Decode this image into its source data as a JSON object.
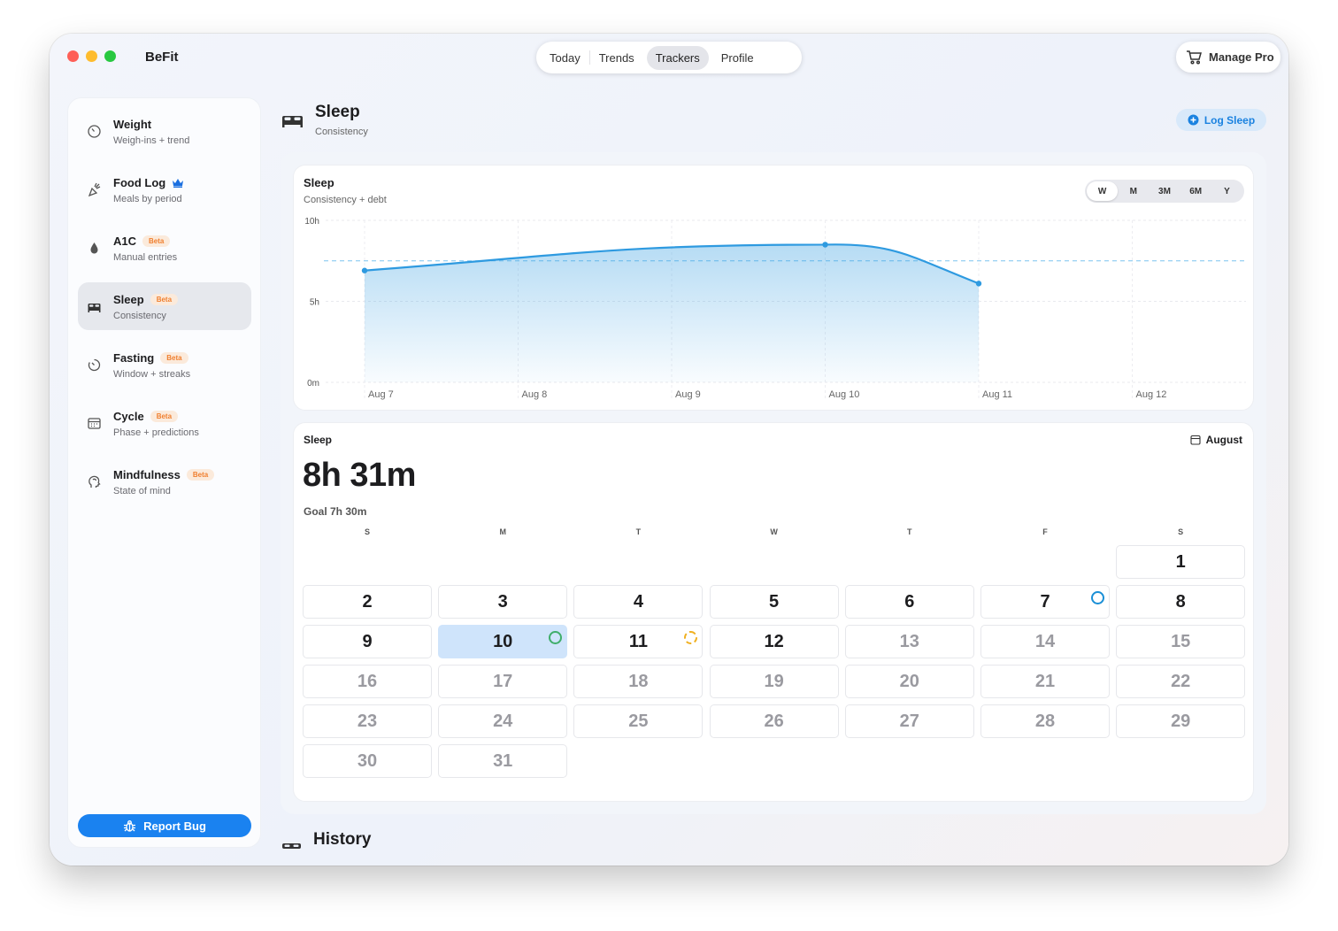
{
  "app": {
    "title": "BeFit"
  },
  "nav": {
    "tabs": [
      {
        "label": "Today"
      },
      {
        "label": "Trends"
      },
      {
        "label": "Trackers",
        "active": true
      },
      {
        "label": "Profile"
      }
    ]
  },
  "manage_pro": {
    "label": "Manage Pro",
    "icon": "cart-icon"
  },
  "sidebar": {
    "items": [
      {
        "title": "Weight",
        "subtitle": "Weigh-ins + trend",
        "icon": "gauge-icon"
      },
      {
        "title": "Food Log",
        "subtitle": "Meals by period",
        "icon": "carrot-icon",
        "badge_icon": "crown-icon"
      },
      {
        "title": "A1C",
        "subtitle": "Manual entries",
        "icon": "drop-icon",
        "badge": "Beta"
      },
      {
        "title": "Sleep",
        "subtitle": "Consistency",
        "icon": "bed-icon",
        "badge": "Beta",
        "active": true
      },
      {
        "title": "Fasting",
        "subtitle": "Window + streaks",
        "icon": "timer-icon",
        "badge": "Beta"
      },
      {
        "title": "Cycle",
        "subtitle": "Phase + predictions",
        "icon": "calendar-icon",
        "badge": "Beta"
      },
      {
        "title": "Mindfulness",
        "subtitle": "State of mind",
        "icon": "head-icon",
        "badge": "Beta"
      }
    ],
    "report_bug": "Report Bug"
  },
  "main": {
    "title": "Sleep",
    "subtitle": "Consistency",
    "log_button": "Log Sleep",
    "history_title": "History"
  },
  "chart_card": {
    "title": "Sleep",
    "subtitle": "Consistency + debt",
    "ranges": [
      "W",
      "M",
      "3M",
      "6M",
      "Y"
    ],
    "active_range": "W"
  },
  "chart_data": {
    "type": "area",
    "x": [
      "Aug 7",
      "Aug 8",
      "Aug 9",
      "Aug 10",
      "Aug 11",
      "Aug 12"
    ],
    "points": [
      {
        "x": "Aug 7",
        "y": 6.9
      },
      {
        "x": "Aug 10",
        "y": 8.5
      },
      {
        "x": "Aug 11",
        "y": 6.1
      }
    ],
    "y_ticks": [
      "0m",
      "5h",
      "10h"
    ],
    "ylim": [
      0,
      10
    ],
    "goal_line": 7.5,
    "color": "#2e9ae0"
  },
  "calendar": {
    "title": "Sleep",
    "month": "August",
    "total": "8h 31m",
    "goal": "Goal 7h 30m",
    "weekdays": [
      "S",
      "M",
      "T",
      "W",
      "T",
      "F",
      "S"
    ],
    "start_offset": 6,
    "days": 31,
    "today": 12,
    "selected": 10,
    "rings": [
      {
        "day": 7,
        "color": "#1a8fd6",
        "style": "solid"
      },
      {
        "day": 10,
        "color": "#3fae6a",
        "style": "solid"
      },
      {
        "day": 11,
        "color": "#f0b020",
        "style": "dashed"
      }
    ]
  }
}
